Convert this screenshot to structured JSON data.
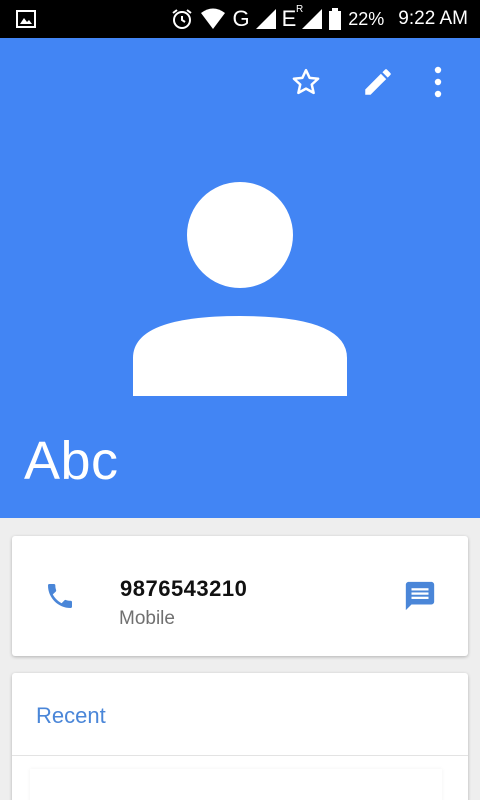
{
  "status_bar": {
    "network_g": "G",
    "network_e": "E",
    "roaming": "R",
    "battery": "22%",
    "time": "9:22 AM"
  },
  "header": {
    "icons": [
      "star-outline-icon",
      "edit-pencil-icon",
      "more-vert-icon"
    ],
    "contact_name": "Abc",
    "accent": "#4285f4"
  },
  "phone": {
    "number": "9876543210",
    "type": "Mobile",
    "icons": [
      "phone-icon",
      "message-icon"
    ]
  },
  "recent": {
    "title": "Recent"
  }
}
